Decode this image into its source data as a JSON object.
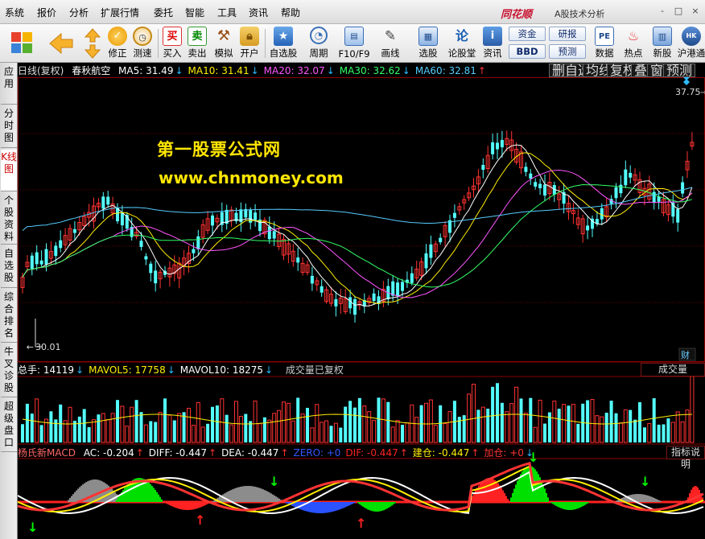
{
  "menu": {
    "items": [
      "系统",
      "报价",
      "分析",
      "扩展行情",
      "委托",
      "智能",
      "工具",
      "资讯",
      "帮助"
    ],
    "brand": "同花顺",
    "app_title": "A股技术分析",
    "window_buttons": [
      "-",
      "□",
      "×"
    ]
  },
  "toolbar": {
    "buttons": [
      {
        "label": "修正",
        "icon": "fix-icon"
      },
      {
        "label": "测速",
        "icon": "speed-clock-icon"
      },
      {
        "label": "买入",
        "icon": "buy-icon",
        "glyph": "买"
      },
      {
        "label": "卖出",
        "icon": "sell-icon",
        "glyph": "卖"
      },
      {
        "label": "模拟",
        "icon": "hammer-icon"
      },
      {
        "label": "开户",
        "icon": "lock-icon"
      },
      {
        "label": "自选股",
        "icon": "star-icon"
      },
      {
        "label": "周期",
        "icon": "clock-icon"
      },
      {
        "label": "F10/F9",
        "icon": "f10-icon"
      },
      {
        "label": "画线",
        "icon": "pen-icon"
      },
      {
        "label": "选股",
        "icon": "select-stock-icon"
      },
      {
        "label": "论股堂",
        "icon": "forum-icon",
        "glyph": "论"
      },
      {
        "label": "资讯",
        "icon": "news-icon"
      },
      {
        "label": "数据",
        "icon": "pe-icon",
        "glyph": "PE"
      },
      {
        "label": "热点",
        "icon": "hot-icon"
      },
      {
        "label": "新股",
        "icon": "ipo-icon"
      },
      {
        "label": "沪港通",
        "icon": "hk-connect-icon"
      }
    ],
    "pills": [
      "资金",
      "BBD",
      "研报",
      "预测"
    ]
  },
  "sidebar": {
    "tabs": [
      "应用",
      "分时图",
      "K线图",
      "个股资料",
      "自选股",
      "综合排名",
      "牛叉诊股",
      "超级盘口"
    ],
    "active_index": 2
  },
  "main_chart": {
    "period_label": "日线(复权)",
    "stock_name": "春秋航空",
    "ma": [
      {
        "label": "MA5: 31.49",
        "arrow": "↓",
        "color": "#ffffff",
        "arrow_class": "arrow-dn"
      },
      {
        "label": "MA10: 31.41",
        "arrow": "↓",
        "color": "#ffee00",
        "arrow_class": "arrow-dn"
      },
      {
        "label": "MA20: 32.07",
        "arrow": "↓",
        "color": "#ff55ff",
        "arrow_class": "arrow-dn"
      },
      {
        "label": "MA30: 32.62",
        "arrow": "↓",
        "color": "#33ff66",
        "arrow_class": "arrow-dn"
      },
      {
        "label": "MA60: 32.81",
        "arrow": "↑",
        "color": "#55ccff",
        "arrow_class": "arrow-up"
      }
    ],
    "tabs": [
      "删自选",
      "均线",
      "复权",
      "叠",
      "窗",
      "预测"
    ],
    "high_label": "37.75",
    "low_label": "30.01",
    "finance_tag": "财"
  },
  "volume_panel": {
    "items": [
      {
        "label": "总手: 14119",
        "arrow": "↓",
        "color": "#ffffff"
      },
      {
        "label": "MAVOL5: 17758",
        "arrow": "↓",
        "color": "#ffee00"
      },
      {
        "label": "MAVOL10: 18275",
        "arrow": "↓",
        "color": "#ffffff"
      }
    ],
    "note": "成交量已复权",
    "tab": "成交量"
  },
  "macd_panel": {
    "name": "杨氏新MACD",
    "items": [
      {
        "label": "AC: -0.204",
        "arrow": "↑",
        "color": "#ffffff",
        "arrow_class": "arrow-up"
      },
      {
        "label": "DIFF: -0.447",
        "arrow": "↑",
        "color": "#ffffff",
        "arrow_class": "arrow-up"
      },
      {
        "label": "DEA: -0.447",
        "arrow": "↑",
        "color": "#ffffff",
        "arrow_class": "arrow-up"
      },
      {
        "label": "ZERO: +0",
        "arrow": "",
        "color": "#3355ff",
        "arrow_class": "arrow-up"
      },
      {
        "label": "DIF: -0.447",
        "arrow": "↑",
        "color": "#ff2222",
        "arrow_class": "arrow-up"
      },
      {
        "label": "建仓: -0.447",
        "arrow": "↑",
        "color": "#ffee00",
        "arrow_class": "arrow-up"
      },
      {
        "label": "加仓: +0",
        "arrow": "↓",
        "color": "#ff3333",
        "arrow_class": "arrow-dn"
      }
    ],
    "tab": "指标说明"
  },
  "watermark": {
    "title": "第一股票公式网",
    "url": "www.chnmoney.com"
  },
  "colors": {
    "up": "#ff3232",
    "down": "#54ffff",
    "ma5": "#ffffff",
    "ma10": "#ffee00",
    "ma20": "#ff55ff",
    "ma30": "#33ff66",
    "ma60": "#55ccff",
    "grid": "#800000"
  }
}
